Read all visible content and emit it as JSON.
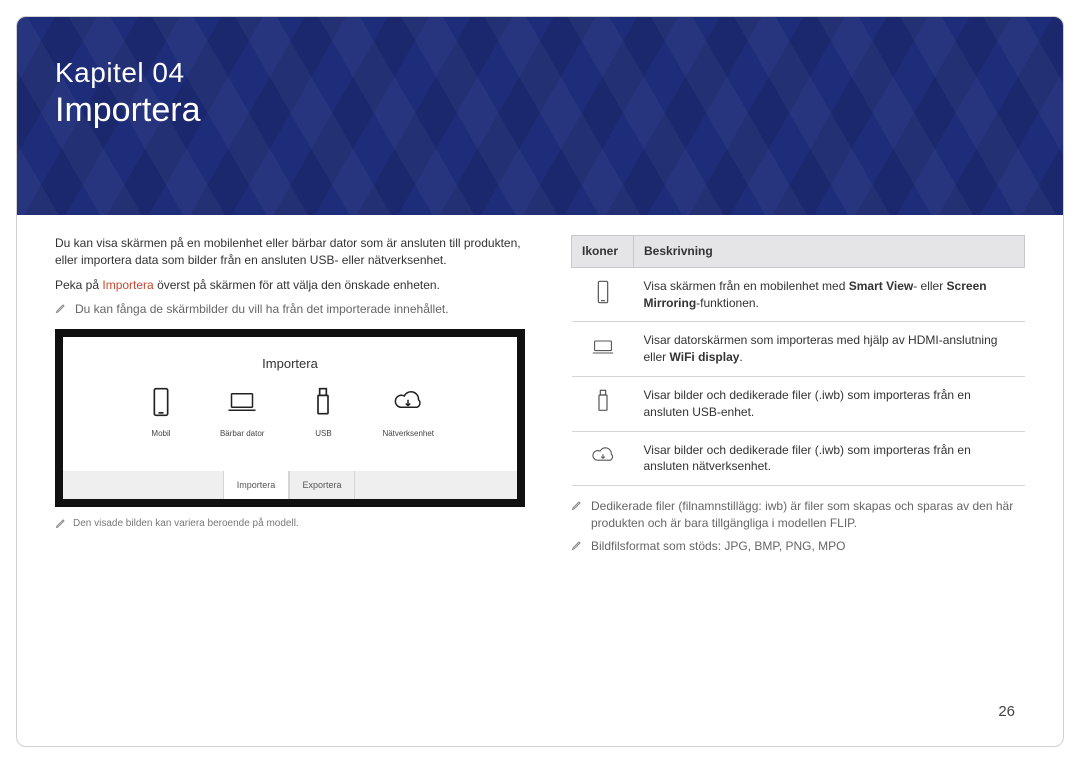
{
  "hero": {
    "chapter": "Kapitel 04",
    "title": "Importera"
  },
  "left": {
    "intro": "Du kan visa skärmen på en mobilenhet eller bärbar dator som är ansluten till produkten, eller importera data som bilder från en ansluten USB- eller nätverksenhet.",
    "instruction_pre": "Peka på ",
    "instruction_accent": "Importera",
    "instruction_post": " överst på skärmen för att välja den önskade enheten.",
    "tip": "Du kan fånga de skärmbilder du vill ha från det importerade innehållet.",
    "mock": {
      "title": "Importera",
      "items": [
        {
          "label": "Mobil"
        },
        {
          "label": "Bärbar dator"
        },
        {
          "label": "USB"
        },
        {
          "label": "Nätverksenhet"
        }
      ],
      "tabs": {
        "active": "Importera",
        "other": "Exportera"
      }
    },
    "caption": "Den visade bilden kan variera beroende på modell."
  },
  "right": {
    "headers": {
      "icons": "Ikoner",
      "desc": "Beskrivning"
    },
    "rows": [
      {
        "pre": "Visa skärmen från en mobilenhet med ",
        "b1": "Smart View",
        "mid": "- eller ",
        "b2": "Screen Mirroring",
        "post": "-funktionen."
      },
      {
        "pre": "Visar datorskärmen som importeras med hjälp av HDMI-anslutning eller ",
        "b1": "WiFi display",
        "post": "."
      },
      {
        "text": "Visar bilder och dedikerade filer (.iwb) som importeras från en ansluten USB-enhet."
      },
      {
        "text": "Visar bilder och dedikerade filer (.iwb) som importeras från en ansluten nätverksenhet."
      }
    ],
    "notes": [
      "Dedikerade filer (filnamnstillägg: iwb) är filer som skapas och sparas av den här produkten och är bara tillgängliga i modellen FLIP.",
      "Bildfilsformat som stöds: JPG, BMP, PNG, MPO"
    ]
  },
  "page_number": "26"
}
